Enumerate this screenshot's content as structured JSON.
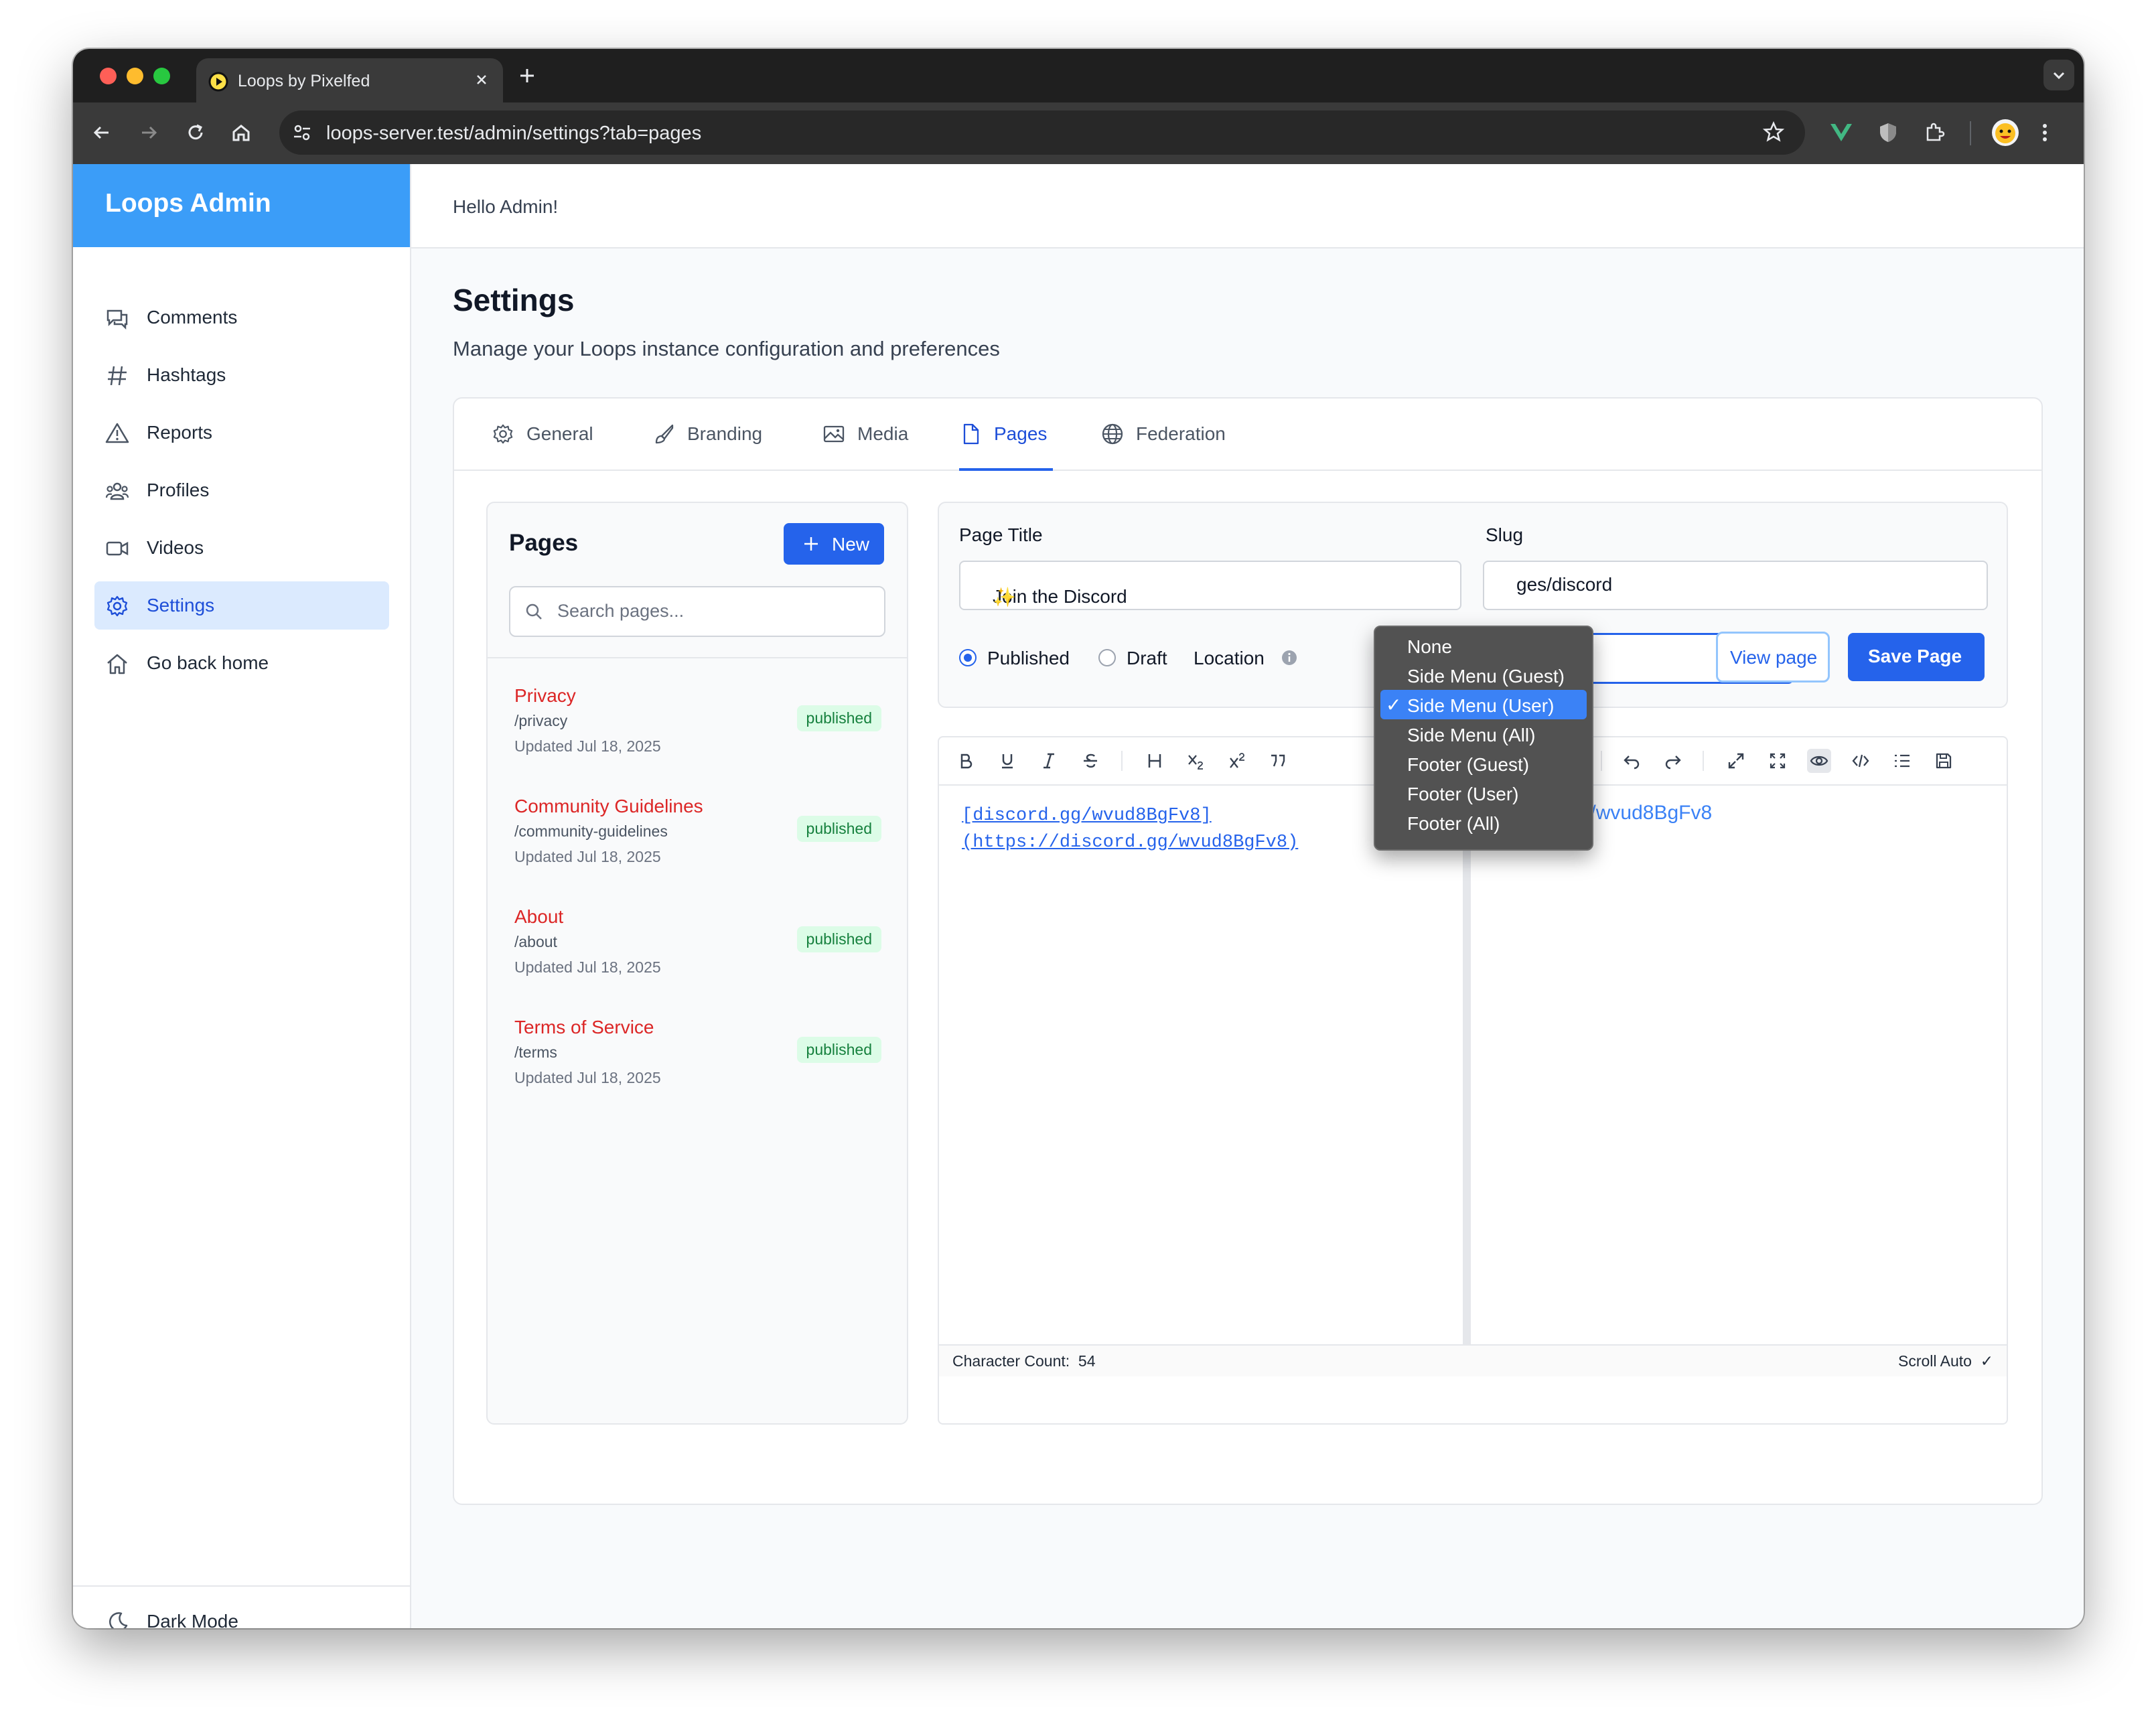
{
  "browser": {
    "tab_title": "Loops by Pixelfed",
    "url": "loops-server.test/admin/settings?tab=pages"
  },
  "sidebar": {
    "brand": "Loops Admin",
    "items": [
      {
        "label": "Comments",
        "icon": "comments-icon"
      },
      {
        "label": "Hashtags",
        "icon": "hashtag-icon"
      },
      {
        "label": "Reports",
        "icon": "warning-icon"
      },
      {
        "label": "Profiles",
        "icon": "users-icon"
      },
      {
        "label": "Videos",
        "icon": "video-camera-icon"
      },
      {
        "label": "Settings",
        "icon": "gear-icon",
        "active": true
      },
      {
        "label": "Go back home",
        "icon": "home-icon"
      }
    ],
    "dark_mode_label": "Dark Mode"
  },
  "header": {
    "greeting": "Hello Admin!"
  },
  "page": {
    "title": "Settings",
    "subtitle": "Manage your Loops instance configuration and preferences"
  },
  "settings_tabs": [
    {
      "label": "General",
      "icon": "gear-icon"
    },
    {
      "label": "Branding",
      "icon": "brush-icon"
    },
    {
      "label": "Media",
      "icon": "image-icon"
    },
    {
      "label": "Pages",
      "icon": "document-icon",
      "active": true
    },
    {
      "label": "Federation",
      "icon": "globe-icon"
    }
  ],
  "pages_panel": {
    "title": "Pages",
    "new_button": "New",
    "search_placeholder": "Search pages...",
    "items": [
      {
        "title": "Privacy",
        "slug": "/privacy",
        "updated": "Updated Jul 18, 2025",
        "status": "published"
      },
      {
        "title": "Community Guidelines",
        "slug": "/community-guidelines",
        "updated": "Updated Jul 18, 2025",
        "status": "published"
      },
      {
        "title": "About",
        "slug": "/about",
        "updated": "Updated Jul 18, 2025",
        "status": "published"
      },
      {
        "title": "Terms of Service",
        "slug": "/terms",
        "updated": "Updated Jul 18, 2025",
        "status": "published"
      }
    ]
  },
  "editor": {
    "page_title_label": "Page Title",
    "page_title_value": "Join the Discord",
    "page_title_emoji": "✨",
    "slug_label": "Slug",
    "slug_value_visible": "ges/discord",
    "published_label": "Published",
    "draft_label": "Draft",
    "location_label": "Location",
    "view_page_button": "View page",
    "save_page_button": "Save Page",
    "markdown_line1": "[discord.gg/wvud8BgFv8]",
    "markdown_line2": "(https://discord.gg/wvud8BgFv8)",
    "preview_link_visible": "discord.gg/wvud8BgFv8",
    "character_count_label": "Character Count:",
    "character_count_value": "54",
    "scroll_auto_label": "Scroll Auto",
    "scroll_auto_check": "✓"
  },
  "location_dropdown": {
    "options": [
      "None",
      "Side Menu (Guest)",
      "Side Menu (User)",
      "Side Menu (All)",
      "Footer (Guest)",
      "Footer (User)",
      "Footer (All)"
    ],
    "selected": "Side Menu (User)",
    "check_mark": "✓"
  },
  "colors": {
    "brand_blue": "#3b9df8",
    "primary": "#2563eb",
    "page_link_red": "#dc2626",
    "published_badge_bg": "#dcfce7",
    "published_badge_text": "#15803d"
  }
}
